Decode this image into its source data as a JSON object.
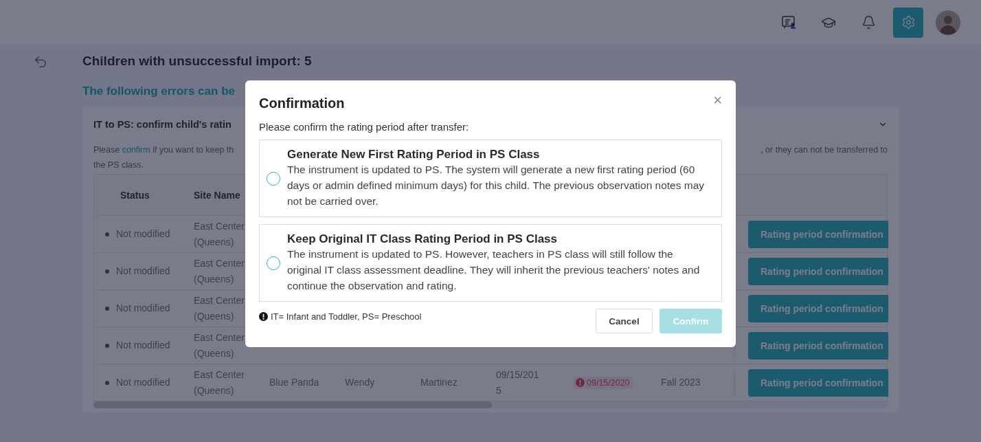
{
  "header": {
    "icons": [
      {
        "kind": "board"
      },
      {
        "kind": "cap"
      },
      {
        "kind": "bell"
      },
      {
        "kind": "settings",
        "selected": true
      }
    ]
  },
  "page": {
    "title": "Children with unsuccessful import: 5",
    "subtitle": "The following errors can be",
    "card": {
      "title": "IT to PS: confirm child's ratin",
      "expanded": true,
      "description_lead": "Please ",
      "description_link": "confirm",
      "description_start": " if you want to keep th",
      "description_end": ", or they can not be transferred to",
      "description_line2": "the PS class.",
      "table": {
        "columns": [
          "Status",
          "Site Name"
        ],
        "rows": [
          {
            "status": "Not modified",
            "site": "East Center (Queens)",
            "action": "Rating period confirmation"
          },
          {
            "status": "Not modified",
            "site": "East Center (Queens)",
            "action": "Rating period confirmation"
          },
          {
            "status": "Not modified",
            "site": "East Center (Queens)",
            "action": "Rating period confirmation"
          },
          {
            "status": "Not modified",
            "site": "East Center (Queens)",
            "action": "Rating period confirmation"
          },
          {
            "status": "Not modified",
            "site": "East Center (Queens)",
            "cells": [
              {
                "kind": "text",
                "text": "Blue Panda"
              },
              {
                "kind": "text",
                "text": "Wendy"
              },
              {
                "kind": "text",
                "text": "Martinez"
              },
              {
                "kind": "wrap",
                "text": "09/15/2015"
              },
              {
                "kind": "error",
                "text": "09/15/2020"
              },
              {
                "kind": "text",
                "text": "Fall 2023"
              }
            ],
            "action": "Rating period confirmation"
          }
        ]
      }
    }
  },
  "modal": {
    "title": "Confirmation",
    "close": "×",
    "prompt": "Please confirm the rating period after transfer:",
    "options": [
      {
        "title": "Generate New First Rating Period in PS Class",
        "text": "The instrument is updated to PS. The system will generate a new first rating period (60 days or admin defined minimum days) for this child. The previous observation notes may not be carried over.",
        "selected": false
      },
      {
        "title": "Keep Original IT Class Rating Period in PS Class",
        "text": "The instrument is updated to PS. However, teachers in PS class will still follow the original IT class assessment deadline. They will inherit the previous teachers' notes and continue the observation and rating.",
        "selected": false
      }
    ],
    "note": "IT= Infant and Toddler, PS= Preschool",
    "buttons": [
      {
        "label": "Cancel",
        "kind": "secondary",
        "disabled": false
      },
      {
        "label": "Confirm",
        "kind": "primary",
        "disabled": true
      }
    ]
  }
}
